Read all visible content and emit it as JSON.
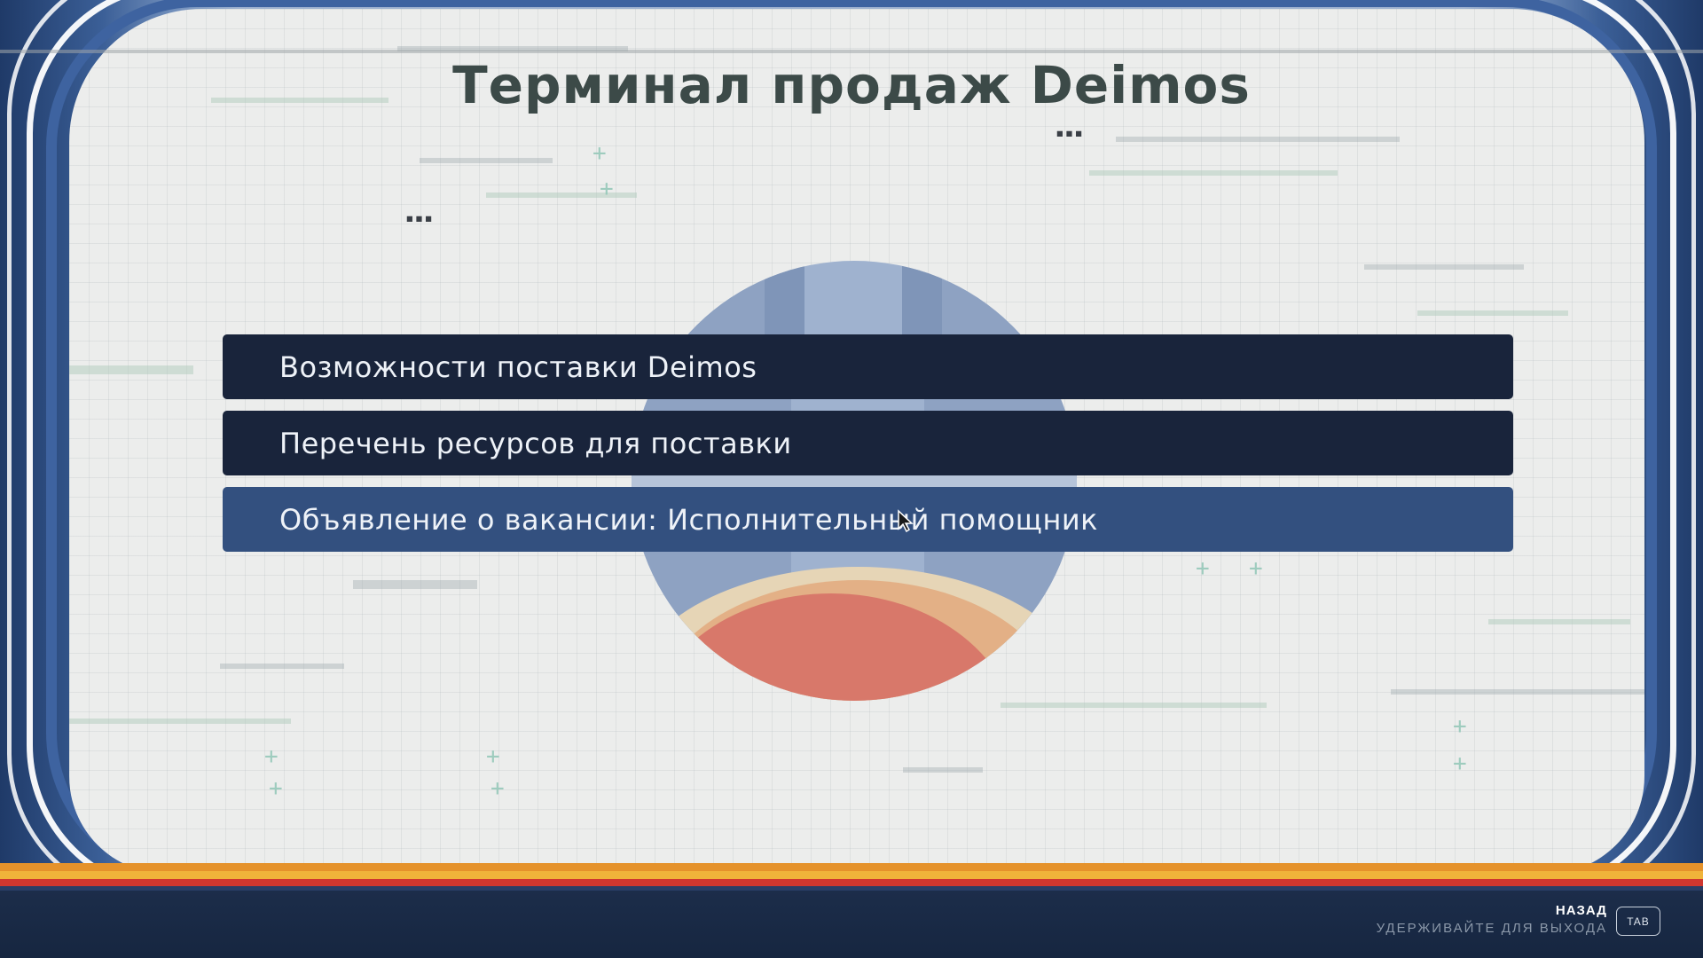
{
  "header": {
    "title": "Терминал продаж Deimos"
  },
  "menu": {
    "items": [
      {
        "label": "Возможности поставки Deimos",
        "selected": false
      },
      {
        "label": "Перечень ресурсов для поставки",
        "selected": false
      },
      {
        "label": "Объявление о вакансии: Исполнительный помощник",
        "selected": true
      }
    ]
  },
  "footer": {
    "back_label": "НАЗАД",
    "hold_label": "УДЕРЖИВАЙТЕ ДЛЯ ВЫХОДА",
    "key_label": "TAB"
  },
  "decor": {
    "emblem": "planet-emblem",
    "cursor": "pointer-cursor-icon"
  },
  "colors": {
    "menu_item_bg": "#19243b",
    "menu_item_selected_bg": "#33507f",
    "frame_blue": "#3e63a0",
    "stripe_orange": "#e5922b",
    "stripe_red": "#d0372f",
    "title_color": "#3c4a48"
  }
}
